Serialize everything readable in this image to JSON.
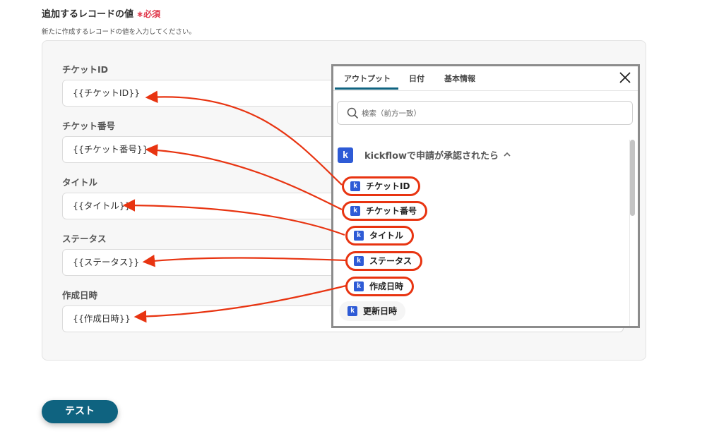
{
  "section": {
    "title": "追加するレコードの値",
    "required_mark": "∗",
    "required_label": "必須",
    "description": "新たに作成するレコードの値を入力してください。"
  },
  "fields": [
    {
      "label": "チケットID",
      "value": "{{チケットID}}"
    },
    {
      "label": "チケット番号",
      "value": "{{チケット番号}}"
    },
    {
      "label": "タイトル",
      "value": "{{タイトル}}"
    },
    {
      "label": "ステータス",
      "value": "{{ステータス}}"
    },
    {
      "label": "作成日時",
      "value": "{{作成日時}}"
    }
  ],
  "test_button": "テスト",
  "popup": {
    "tabs": [
      "アウトプット",
      "日付",
      "基本情報"
    ],
    "active_tab": "アウトプット",
    "search_placeholder": "検索（前方一致）",
    "group": {
      "logo": "k",
      "name": "kickflowで申請が承認されたら",
      "expanded": true
    },
    "items": [
      {
        "icon": "k",
        "label": "チケットID",
        "highlighted": true
      },
      {
        "icon": "k",
        "label": "チケット番号",
        "highlighted": true
      },
      {
        "icon": "k",
        "label": "タイトル",
        "highlighted": true
      },
      {
        "icon": "k",
        "label": "ステータス",
        "highlighted": true
      },
      {
        "icon": "k",
        "label": "作成日時",
        "highlighted": true
      },
      {
        "icon": "k",
        "label": "更新日時",
        "highlighted": false
      }
    ]
  },
  "colors": {
    "accent": "#0f6380",
    "annotation": "#e83411",
    "brand": "#2e5bd6",
    "required": "#e0384b"
  }
}
